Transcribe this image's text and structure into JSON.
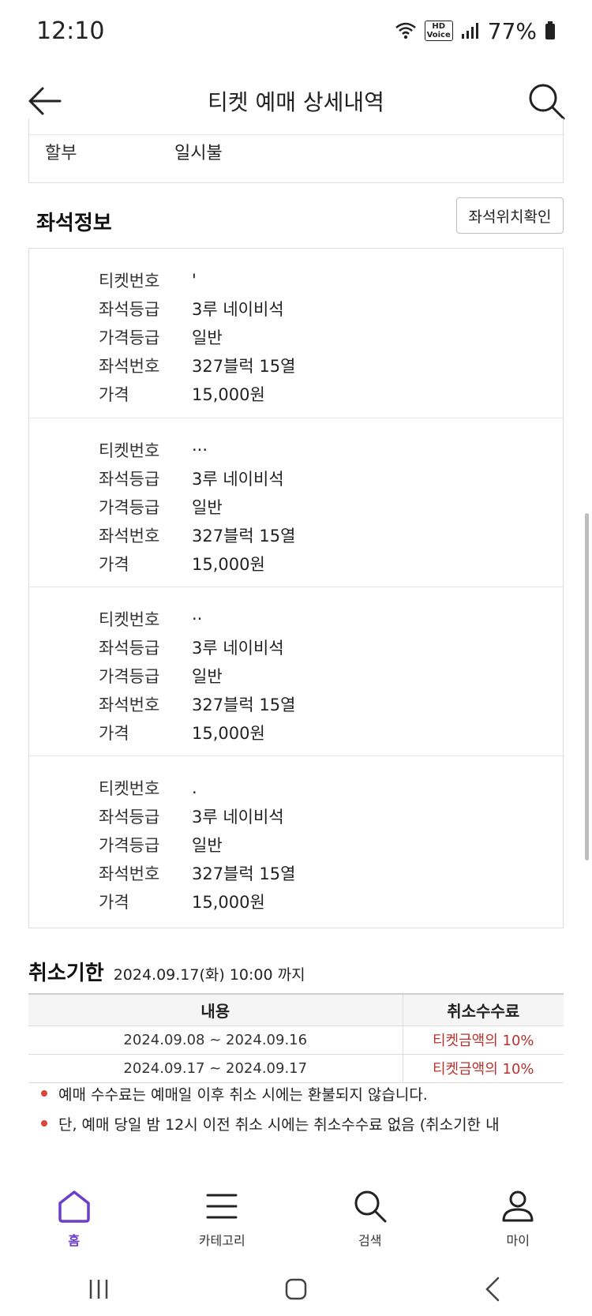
{
  "status_bar": {
    "time": "12:10",
    "hd": "HD",
    "voice": "Voice",
    "battery": "77%"
  },
  "app_bar": {
    "title": "티켓 예매 상세내역"
  },
  "payment": {
    "installment_label": "할부",
    "installment_value": "일시불"
  },
  "seat_section": {
    "title": "좌석정보",
    "location_button": "좌석위치확인",
    "labels": {
      "ticket_no": "티켓번호",
      "seat_grade": "좌석등급",
      "price_grade": "가격등급",
      "seat_no": "좌석번호",
      "price": "가격"
    },
    "tickets": [
      {
        "ticket_no": "'",
        "seat_grade": "3루 네이비석",
        "price_grade": "일반",
        "seat_no": "327블럭 15열",
        "price": "15,000원"
      },
      {
        "ticket_no": "···",
        "seat_grade": "3루 네이비석",
        "price_grade": "일반",
        "seat_no": "327블럭 15열",
        "price": "15,000원"
      },
      {
        "ticket_no": "··",
        "seat_grade": "3루 네이비석",
        "price_grade": "일반",
        "seat_no": "327블럭 15열",
        "price": "15,000원"
      },
      {
        "ticket_no": ".",
        "seat_grade": "3루 네이비석",
        "price_grade": "일반",
        "seat_no": "327블럭 15열",
        "price": "15,000원"
      }
    ]
  },
  "cancel_section": {
    "title": "취소기한",
    "deadline": "2024.09.17(화) 10:00 까지",
    "table": {
      "headers": [
        "내용",
        "취소수수료"
      ],
      "rows": [
        {
          "period": "2024.09.08 ~ 2024.09.16",
          "fee": "티켓금액의 10%"
        },
        {
          "period": "2024.09.17 ~ 2024.09.17",
          "fee": "티켓금액의 10%"
        }
      ]
    },
    "notes": [
      "예매 수수료는 예매일 이후 취소 시에는 환불되지 않습니다.",
      "단, 예매 당일 밤 12시 이전 취소 시에는 취소수수료 없음 (취소기한 내"
    ]
  },
  "bottom_nav": {
    "items": [
      {
        "label": "홈",
        "icon": "home-icon",
        "active": true
      },
      {
        "label": "카테고리",
        "icon": "menu-icon",
        "active": false
      },
      {
        "label": "검색",
        "icon": "search-icon",
        "active": false
      },
      {
        "label": "마이",
        "icon": "user-icon",
        "active": false
      }
    ]
  },
  "colors": {
    "accent": "#6d3fc8",
    "fee_red": "#b8322e",
    "bullet": "#d9453b"
  }
}
